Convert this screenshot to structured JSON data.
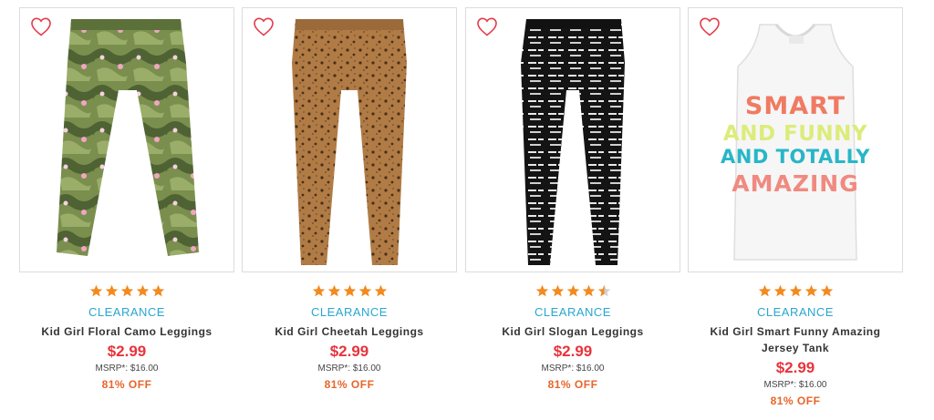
{
  "colors": {
    "star": "#f28a1f",
    "star_empty": "#cfcfcf",
    "clearance": "#2aa6cf",
    "price": "#e8333c",
    "discount": "#e8642a",
    "heart": "#e23b48"
  },
  "products": [
    {
      "name": "Kid Girl Floral Camo Leggings",
      "badge": "CLEARANCE",
      "rating": 5,
      "price": "$2.99",
      "msrp_label": "MSRP*:",
      "msrp_value": "$16.00",
      "discount": "81% OFF",
      "image_icon": "floral-camo-leggings-image"
    },
    {
      "name": "Kid Girl Cheetah Leggings",
      "badge": "CLEARANCE",
      "rating": 5,
      "price": "$2.99",
      "msrp_label": "MSRP*:",
      "msrp_value": "$16.00",
      "discount": "81% OFF",
      "image_icon": "cheetah-leggings-image"
    },
    {
      "name": "Kid Girl Slogan Leggings",
      "badge": "CLEARANCE",
      "rating": 4.5,
      "price": "$2.99",
      "msrp_label": "MSRP*:",
      "msrp_value": "$16.00",
      "discount": "81% OFF",
      "image_icon": "slogan-leggings-image"
    },
    {
      "name": "Kid Girl Smart Funny Amazing Jersey Tank",
      "badge": "CLEARANCE",
      "rating": 5,
      "price": "$2.99",
      "msrp_label": "MSRP*:",
      "msrp_value": "$16.00",
      "discount": "81% OFF",
      "image_icon": "slogan-tank-top-image",
      "tank_print": [
        "SMART",
        "AND FUNNY",
        "AND TOTALLY",
        "AMAZING"
      ]
    }
  ]
}
